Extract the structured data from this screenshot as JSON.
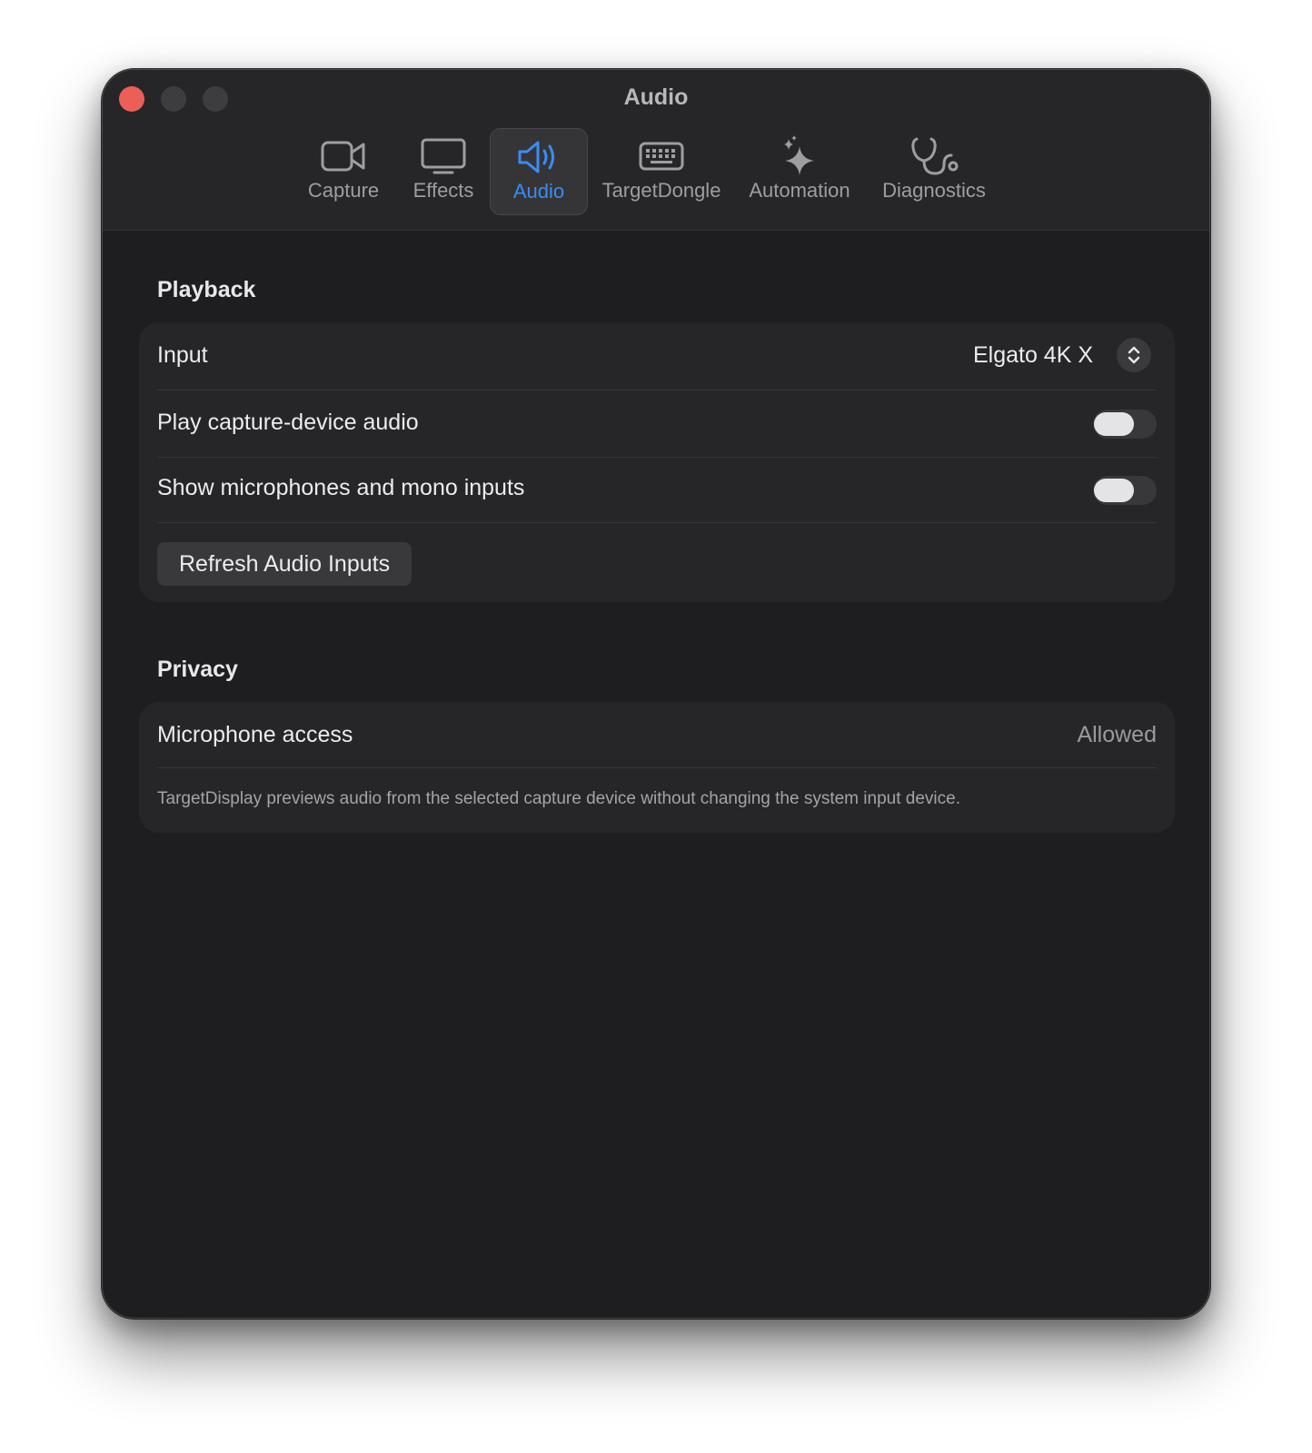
{
  "window": {
    "title": "Audio"
  },
  "tabs": [
    {
      "label": "Capture",
      "icon": "video-camera-icon",
      "active": false
    },
    {
      "label": "Effects",
      "icon": "display-icon",
      "active": false
    },
    {
      "label": "Audio",
      "icon": "speaker-wave-icon",
      "active": true
    },
    {
      "label": "TargetDongle",
      "icon": "keyboard-icon",
      "active": false
    },
    {
      "label": "Automation",
      "icon": "sparkles-icon",
      "active": false
    },
    {
      "label": "Diagnostics",
      "icon": "stethoscope-icon",
      "active": false
    }
  ],
  "playback": {
    "title": "Playback",
    "input_label": "Input",
    "input_value": "Elgato 4K X",
    "play_audio_label": "Play capture-device audio",
    "play_audio_on": false,
    "show_mics_label": "Show microphones and mono inputs",
    "show_mics_on": false,
    "refresh_button": "Refresh Audio Inputs"
  },
  "privacy": {
    "title": "Privacy",
    "mic_label": "Microphone access",
    "mic_value": "Allowed",
    "footnote": "TargetDisplay previews audio from the selected capture device without changing the system input device."
  },
  "colors": {
    "accent": "#3b8cf5",
    "close": "#ec5f58",
    "window_bg": "#1e1e20"
  }
}
